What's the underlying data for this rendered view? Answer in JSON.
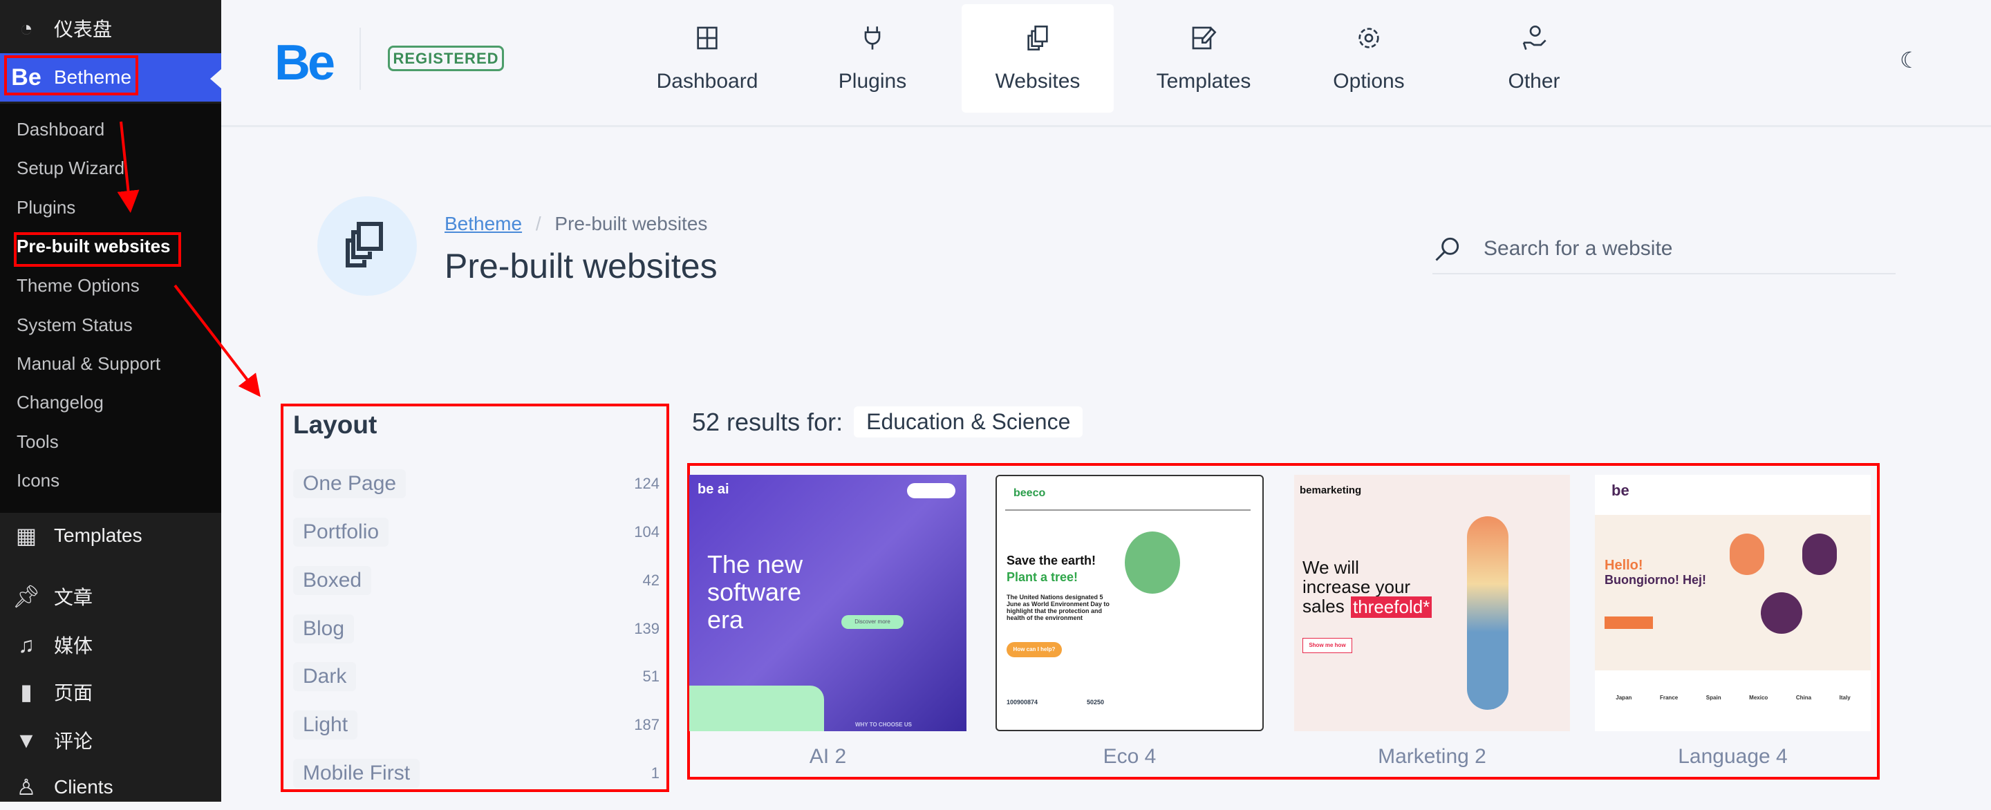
{
  "sidebar": {
    "dashboard_cn": "仪表盘",
    "betheme": "Betheme",
    "submenu": [
      "Dashboard",
      "Setup Wizard",
      "Plugins",
      "Pre-built websites",
      "Theme Options",
      "System Status",
      "Manual & Support",
      "Changelog",
      "Tools",
      "Icons"
    ],
    "templates": "Templates",
    "posts": "文章",
    "media": "媒体",
    "pages": "页面",
    "comments": "评论",
    "clients": "Clients"
  },
  "header": {
    "logo": "Be",
    "badge": "REGISTERED",
    "nav": [
      "Dashboard",
      "Plugins",
      "Websites",
      "Templates",
      "Options",
      "Other"
    ],
    "active": "Websites"
  },
  "page": {
    "breadcrumb_root": "Betheme",
    "breadcrumb_sep": "/",
    "breadcrumb_current": "Pre-built websites",
    "title": "Pre-built websites",
    "search_placeholder": "Search for a website"
  },
  "filters": {
    "title": "Layout",
    "items": [
      {
        "label": "One Page",
        "count": "124"
      },
      {
        "label": "Portfolio",
        "count": "104"
      },
      {
        "label": "Boxed",
        "count": "42"
      },
      {
        "label": "Blog",
        "count": "139"
      },
      {
        "label": "Dark",
        "count": "51"
      },
      {
        "label": "Light",
        "count": "187"
      },
      {
        "label": "Mobile First",
        "count": "1"
      }
    ]
  },
  "results": {
    "text": "52 results for:",
    "category": "Education & Science"
  },
  "cards": [
    {
      "name": "AI 2",
      "thumb": {
        "logo": "be ai",
        "headline": "The new software era",
        "cta": "Discover more",
        "footer": "WHY TO CHOOSE US"
      }
    },
    {
      "name": "Eco 4",
      "thumb": {
        "logo": "beeco",
        "headline": "Save the earth!",
        "headline2": "Plant a tree!",
        "body": "The United Nations designated 5 June as World Environment Day to highlight that the protection and health of the environment",
        "cta": "How can I help?",
        "stat1": "100900874",
        "stat2": "50250"
      }
    },
    {
      "name": "Marketing 2",
      "thumb": {
        "logo": "bemarketing",
        "headline": "We will increase your sales",
        "highlight": "threefold*",
        "cta": "Show me how"
      }
    },
    {
      "name": "Language 4",
      "thumb": {
        "logo": "be",
        "headline": "Hello!",
        "headline2": "Buongiorno! Hej!",
        "countries": [
          "Japan",
          "France",
          "Spain",
          "Mexico",
          "China",
          "Italy"
        ]
      }
    }
  ],
  "colors": {
    "wp_active": "#3858e9",
    "accent": "#0e7ff0",
    "annotation": "#ff0000",
    "registered": "#3b8d58"
  }
}
